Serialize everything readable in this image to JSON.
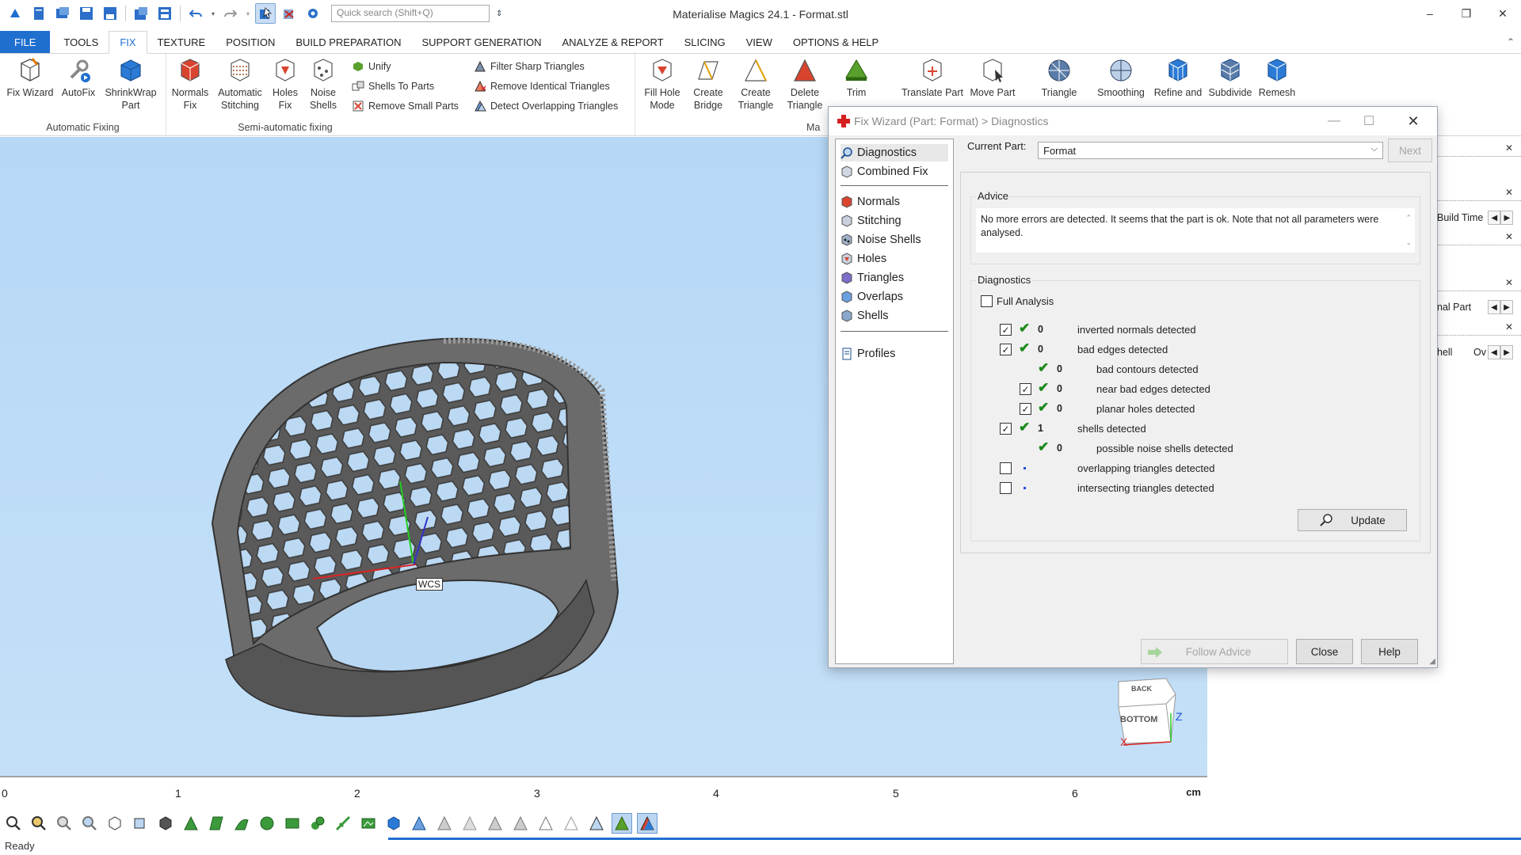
{
  "app": {
    "title": "Materialise Magics 24.1 - Format.stl",
    "search_placeholder": "Quick search (Shift+Q)",
    "window_controls": [
      "–",
      "❐",
      "✕"
    ]
  },
  "ribbon_tabs": [
    "FILE",
    "TOOLS",
    "FIX",
    "TEXTURE",
    "POSITION",
    "BUILD PREPARATION",
    "SUPPORT GENERATION",
    "ANALYZE & REPORT",
    "SLICING",
    "VIEW",
    "OPTIONS & HELP"
  ],
  "ribbon": {
    "automatic_fixing": {
      "label": "Automatic Fixing",
      "buttons": [
        {
          "line1": "Fix Wizard",
          "line2": ""
        },
        {
          "line1": "AutoFix",
          "line2": ""
        },
        {
          "line1": "ShrinkWrap",
          "line2": "Part"
        }
      ]
    },
    "semi_automatic": {
      "label": "Semi-automatic fixing",
      "buttons": [
        {
          "line1": "Normals",
          "line2": "Fix"
        },
        {
          "line1": "Automatic",
          "line2": "Stitching"
        },
        {
          "line1": "Holes",
          "line2": "Fix"
        },
        {
          "line1": "Noise",
          "line2": "Shells"
        }
      ],
      "small": [
        "Unify",
        "Shells To Parts",
        "Remove Small Parts"
      ]
    },
    "triangle_tools": [
      "Filter Sharp Triangles",
      "Remove Identical Triangles",
      "Detect Overlapping Triangles"
    ],
    "manual": {
      "label": "Ma",
      "buttons": [
        {
          "line1": "Fill Hole",
          "line2": "Mode"
        },
        {
          "line1": "Create",
          "line2": "Bridge"
        },
        {
          "line1": "Create",
          "line2": "Triangle"
        },
        {
          "line1": "Delete",
          "line2": "Triangle"
        },
        {
          "line1": "Trim",
          "line2": ""
        },
        {
          "line1": "Translate Part",
          "line2": ""
        },
        {
          "line1": "Move Part",
          "line2": ""
        }
      ]
    },
    "mesh": [
      {
        "line1": "Triangle",
        "line2": ""
      },
      {
        "line1": "Smoothing",
        "line2": ""
      },
      {
        "line1": "Refine and",
        "line2": ""
      },
      {
        "line1": "Subdivide",
        "line2": ""
      },
      {
        "line1": "Remesh",
        "line2": ""
      }
    ]
  },
  "viewport": {
    "wcs_label": "WCS",
    "view_cube": {
      "back": "BACK",
      "bottom": "BOTTOM",
      "z": "Z",
      "x": "X"
    },
    "ruler": {
      "ticks": [
        "0",
        "1",
        "2",
        "3",
        "4",
        "5",
        "6"
      ],
      "unit": "cm"
    }
  },
  "side_panel": {
    "build_time": "Build Time",
    "normal_part": "nal Part",
    "shell": "hell",
    "ov": "Ov"
  },
  "status": {
    "text": "Ready"
  },
  "dialog": {
    "title": "Fix Wizard (Part: Format) > Diagnostics",
    "nav": {
      "top": [
        "Diagnostics",
        "Combined Fix"
      ],
      "middle": [
        "Normals",
        "Stitching",
        "Noise Shells",
        "Holes",
        "Triangles",
        "Overlaps",
        "Shells"
      ],
      "bottom": [
        "Profiles"
      ]
    },
    "current_part_label": "Current Part:",
    "current_part_value": "Format",
    "next_label": "Next",
    "advice_label": "Advice",
    "advice_text": "No more errors are detected. It seems that the part is ok. Note that not all parameters were analysed.",
    "diagnostics_label": "Diagnostics",
    "full_analysis_label": "Full Analysis",
    "rows": [
      {
        "count": "0",
        "text": "inverted normals detected",
        "checked": true,
        "status": "ok",
        "indent": 0
      },
      {
        "count": "0",
        "text": "bad edges detected",
        "checked": true,
        "status": "ok",
        "indent": 0
      },
      {
        "count": "0",
        "text": "bad contours detected",
        "checked": null,
        "status": "ok",
        "indent": 1
      },
      {
        "count": "0",
        "text": "near bad edges detected",
        "checked": true,
        "status": "ok",
        "indent": 1
      },
      {
        "count": "0",
        "text": "planar holes detected",
        "checked": true,
        "status": "ok",
        "indent": 1
      },
      {
        "count": "1",
        "text": "shells detected",
        "checked": true,
        "status": "ok",
        "indent": 0
      },
      {
        "count": "0",
        "text": "possible noise shells detected",
        "checked": null,
        "status": "ok",
        "indent": 1
      },
      {
        "count": "",
        "text": "overlapping triangles detected",
        "checked": false,
        "status": "none",
        "indent": 0
      },
      {
        "count": "",
        "text": "intersecting triangles detected",
        "checked": false,
        "status": "none",
        "indent": 0
      }
    ],
    "update_label": "Update",
    "follow_advice_label": "Follow Advice",
    "close_label": "Close",
    "help_label": "Help"
  },
  "colors": {
    "accent": "#1f6fcf",
    "viewport_bg": "#b6d8f6",
    "ok_green": "#1c8a1c"
  }
}
